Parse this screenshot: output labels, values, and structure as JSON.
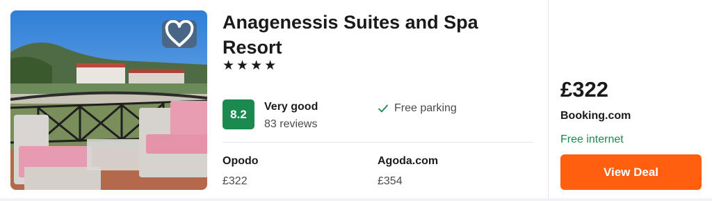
{
  "hotel": {
    "name": "Anagenessis Suites and Spa Resort",
    "stars": "★★★★",
    "star_count": 4,
    "photo_icon": "hotel-balcony-photo",
    "favorite_icon": "heart-icon"
  },
  "rating": {
    "score": "8.2",
    "label": "Very good",
    "reviews": "83 reviews",
    "badge_color": "#1b8a4e"
  },
  "amenity": {
    "icon": "check-icon",
    "label": "Free parking"
  },
  "other_providers": [
    {
      "name": "Opodo",
      "price": "£322"
    },
    {
      "name": "Agoda.com",
      "price": "£354"
    }
  ],
  "deal": {
    "price": "£322",
    "provider": "Booking.com",
    "perk": "Free internet",
    "perk_color": "#1b8a4e",
    "button_label": "View Deal",
    "button_color": "#ff5f0f"
  }
}
